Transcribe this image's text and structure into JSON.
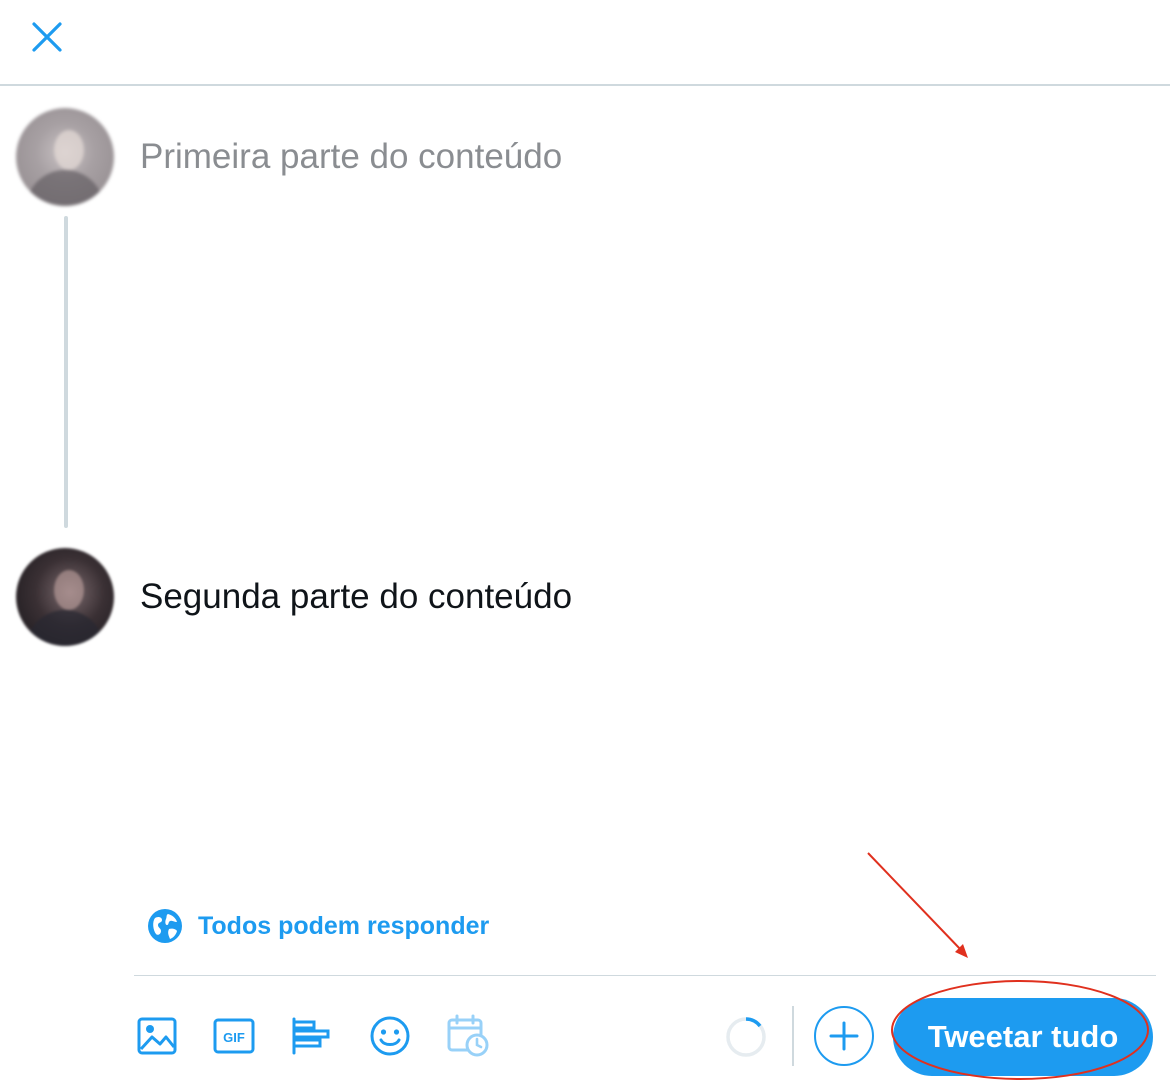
{
  "header": {
    "close_icon": "close-icon"
  },
  "thread": [
    {
      "text": "Primeira parte do conteúdo",
      "state": "placeholder"
    },
    {
      "text": "Segunda parte do conteúdo",
      "state": "filled"
    }
  ],
  "reply_setting": {
    "label": "Todos podem responder",
    "icon": "globe-icon"
  },
  "toolbar": {
    "tools": [
      {
        "name": "media-icon",
        "enabled": true
      },
      {
        "name": "gif-icon",
        "label": "GIF",
        "enabled": true
      },
      {
        "name": "poll-icon",
        "enabled": true
      },
      {
        "name": "emoji-icon",
        "enabled": true
      },
      {
        "name": "schedule-icon",
        "enabled": false
      }
    ],
    "add_icon": "plus-icon",
    "tweet_button_label": "Tweetar tudo"
  },
  "colors": {
    "accent": "#1d9bf0",
    "annotation": "#e0301e",
    "divider": "#cfd9de"
  }
}
